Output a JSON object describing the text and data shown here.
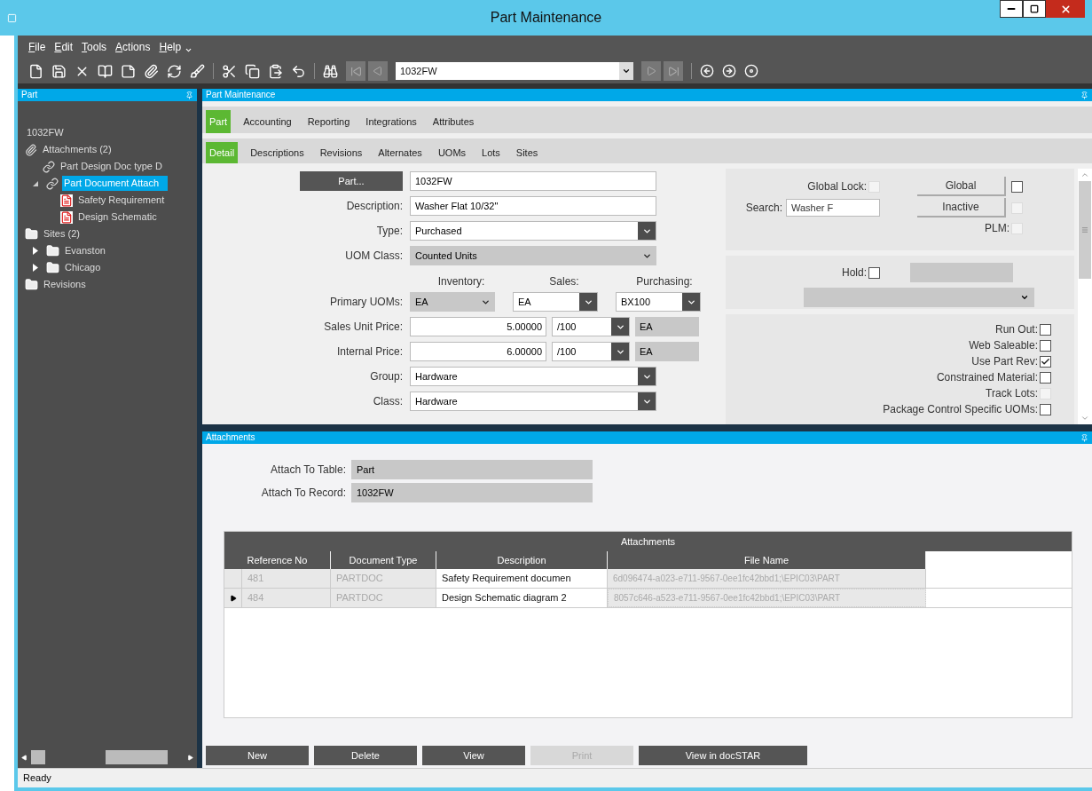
{
  "window": {
    "title": "Part Maintenance"
  },
  "menu": [
    "File",
    "Edit",
    "Tools",
    "Actions",
    "Help"
  ],
  "toolbar": {
    "record": "1032FW"
  },
  "part_panel": {
    "title": "Part",
    "tree": [
      {
        "label": "1032FW",
        "kind": "part",
        "selected": false
      },
      {
        "label": "Attachments (2)",
        "kind": "attachments",
        "selected": false,
        "children": [
          {
            "label": "Part Design Doc type D",
            "kind": "link",
            "selected": false
          },
          {
            "label": "Part Document Attach",
            "kind": "link",
            "selected": true,
            "expanded": true,
            "children": [
              {
                "label": "Safety Requirement",
                "kind": "pdf",
                "selected": false
              },
              {
                "label": "Design Schematic",
                "kind": "pdf",
                "selected": false
              }
            ]
          }
        ]
      },
      {
        "label": "Sites (2)",
        "kind": "folder",
        "selected": false,
        "children": [
          {
            "label": "Evanston",
            "kind": "folder",
            "selected": false,
            "expanded": false
          },
          {
            "label": "Chicago",
            "kind": "folder",
            "selected": false,
            "expanded": false
          }
        ]
      },
      {
        "label": "Revisions",
        "kind": "folder",
        "selected": false
      }
    ]
  },
  "main_panel": {
    "title": "Part Maintenance",
    "tabs": [
      {
        "label": "Part",
        "selected": true
      },
      {
        "label": "Accounting",
        "selected": false
      },
      {
        "label": "Reporting",
        "selected": false
      },
      {
        "label": "Integrations",
        "selected": false
      },
      {
        "label": "Attributes",
        "selected": false
      }
    ],
    "subtabs": [
      {
        "label": "Detail",
        "selected": true
      },
      {
        "label": "Descriptions",
        "selected": false
      },
      {
        "label": "Revisions",
        "selected": false
      },
      {
        "label": "Alternates",
        "selected": false
      },
      {
        "label": "UOMs",
        "selected": false
      },
      {
        "label": "Lots",
        "selected": false
      },
      {
        "label": "Sites",
        "selected": false
      }
    ],
    "rows": [
      {
        "kind": "lookup",
        "label": "Part...",
        "value": "1032FW"
      },
      {
        "kind": "text",
        "label": "Description:",
        "value": "Washer Flat 10/32\""
      },
      {
        "kind": "select",
        "label": "Type:",
        "value": "Purchased",
        "disabled": false
      },
      {
        "kind": "select",
        "label": "UOM Class:",
        "value": "Counted Units",
        "disabled": true
      },
      {
        "kind": "headers",
        "headers": [
          "Inventory:",
          "Sales:",
          "Purchasing:"
        ]
      },
      {
        "kind": "uoms",
        "label": "Primary UOMs:",
        "values": [
          {
            "value": "EA",
            "disabled": true
          },
          {
            "value": "EA",
            "disabled": false
          },
          {
            "value": "BX100",
            "disabled": false
          }
        ]
      },
      {
        "kind": "price",
        "label": "Sales Unit Price:",
        "value": "5.00000",
        "per": "/100",
        "uom": "EA"
      },
      {
        "kind": "price",
        "label": "Internal Price:",
        "value": "6.00000",
        "per": "/100",
        "uom": "EA"
      },
      {
        "kind": "select",
        "label": "Group:",
        "value": "Hardware",
        "disabled": false
      },
      {
        "kind": "select",
        "label": "Class:",
        "value": "Hardware",
        "disabled": false
      }
    ],
    "global_lock": {
      "label": "Global Lock:",
      "checked": false,
      "disabled": true
    },
    "global": {
      "label": "Global",
      "checked": false,
      "disabled": false
    },
    "search": {
      "label": "Search:",
      "value": "Washer F"
    },
    "inactive": {
      "label": "Inactive",
      "checked": false,
      "disabled": true
    },
    "plm": {
      "label": "PLM:",
      "checked": false,
      "disabled": true
    },
    "hold": {
      "label": "Hold:",
      "checked": false,
      "disabled": false
    },
    "flags": [
      {
        "label": "Run Out:",
        "checked": false,
        "disabled": false
      },
      {
        "label": "Web Saleable:",
        "checked": false,
        "disabled": false
      },
      {
        "label": "Use Part Rev:",
        "checked": true,
        "disabled": false
      },
      {
        "label": "Constrained Material:",
        "checked": false,
        "disabled": false
      },
      {
        "label": "Track Lots:",
        "checked": false,
        "disabled": true
      },
      {
        "label": "Package Control Specific UOMs:",
        "checked": false,
        "disabled": false
      }
    ]
  },
  "attachments_panel": {
    "title": "Attachments",
    "fields": [
      {
        "label": "Attach To Table:",
        "value": "Part"
      },
      {
        "label": "Attach To Record:",
        "value": "1032FW"
      }
    ],
    "grid": {
      "title": "Attachments",
      "columns": [
        "Reference No",
        "Document Type",
        "Description",
        "File Name"
      ],
      "rows": [
        {
          "selected": false,
          "cells": [
            "481",
            "PARTDOC",
            "Safety Requirement documen",
            "6d096474-a023-e711-9567-0ee1fc42bbd1;\\EPIC03\\PART"
          ]
        },
        {
          "selected": true,
          "cells": [
            "484",
            "PARTDOC",
            "Design Schematic diagram 2",
            "8057c646-a523-e711-9567-0ee1fc42bbd1;\\EPIC03\\PART"
          ]
        }
      ]
    },
    "buttons": [
      {
        "label": "New",
        "disabled": false
      },
      {
        "label": "Delete",
        "disabled": false
      },
      {
        "label": "View",
        "disabled": false
      },
      {
        "label": "Print",
        "disabled": true
      },
      {
        "label": "View in docSTAR",
        "disabled": false
      }
    ]
  },
  "status_bar": {
    "text": "Ready"
  }
}
